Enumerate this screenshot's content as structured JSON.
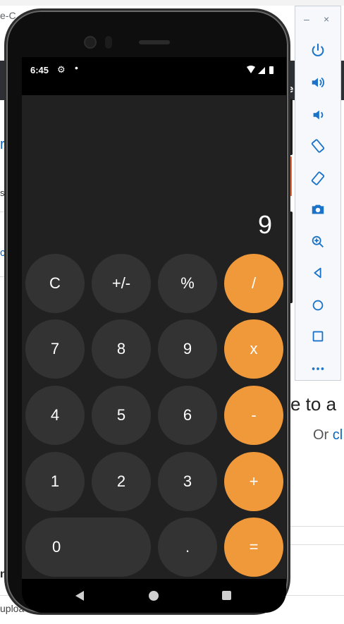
{
  "background_page": {
    "top_text": "e-C",
    "left_link": "r",
    "left_s": "s",
    "left_c": "c",
    "right_e": "e",
    "heading": "e to a",
    "or_text": "Or ",
    "or_link": "cl",
    "left_h": "n",
    "upload_text": "uploa"
  },
  "emulator_toolbar": {
    "minimize": "–",
    "close": "×",
    "buttons": [
      "power-icon",
      "volume-up-icon",
      "volume-down-icon",
      "rotate-left-icon",
      "rotate-right-icon",
      "camera-icon",
      "zoom-icon",
      "back-icon",
      "home-icon",
      "overview-icon",
      "more-icon"
    ]
  },
  "status_bar": {
    "time": "6:45",
    "settings_glyph": "⚙",
    "dot": "•"
  },
  "calculator": {
    "display": "9",
    "keys": {
      "clear": "C",
      "sign": "+/-",
      "percent": "%",
      "divide": "/",
      "seven": "7",
      "eight": "8",
      "nine": "9",
      "multiply": "x",
      "four": "4",
      "five": "5",
      "six": "6",
      "subtract": "-",
      "one": "1",
      "two": "2",
      "three": "3",
      "add": "+",
      "zero": "0",
      "decimal": ".",
      "equals": "="
    },
    "colors": {
      "background": "#212121",
      "key": "#333333",
      "operator": "#f0993a",
      "text": "#ffffff"
    }
  }
}
